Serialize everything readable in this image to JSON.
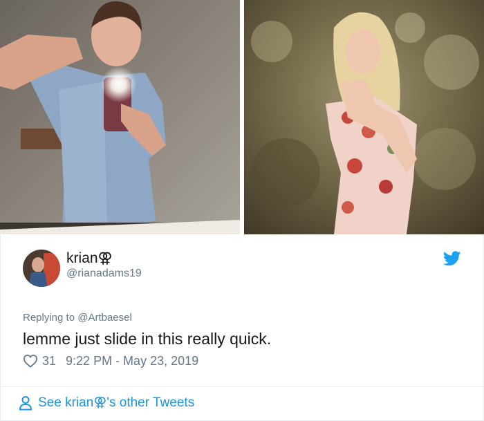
{
  "photos": [
    {
      "subject": "mirror-selfie-photo"
    },
    {
      "subject": "floral-dress-portrait-photo"
    }
  ],
  "tweet": {
    "display_name": "krian⚢",
    "handle": "@rianadams19",
    "replying_to": "Replying to @Artbaesel",
    "text": "lemme just slide in this really quick.",
    "likes": "31",
    "timestamp": "9:22 PM - May 23, 2019",
    "footer_link": "See krian⚢'s other Tweets"
  },
  "icons": {
    "twitter": "twitter-bird-icon",
    "like": "heart-icon",
    "profile": "person-icon"
  },
  "colors": {
    "accent": "#1da1f2",
    "link": "#1b95e0",
    "muted": "#657786",
    "text": "#14171a"
  }
}
